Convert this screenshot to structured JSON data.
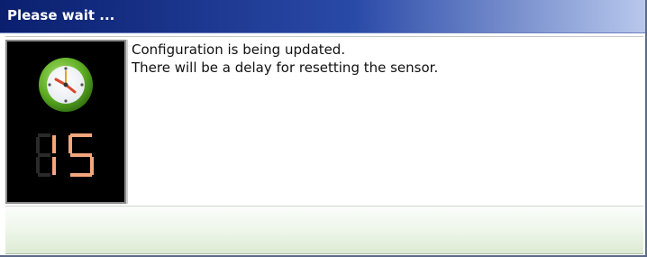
{
  "dialog": {
    "title": "Please wait ...",
    "message_line1": "Configuration is being updated.",
    "message_line2": "There will be a delay for resetting the sensor."
  },
  "countdown": {
    "value": "15",
    "digit_on_color": "#f4a67c",
    "digit_off_color": "#2a2a2a"
  },
  "colors": {
    "titlebar_start": "#0a1f6e",
    "titlebar_end": "#b8c8ec",
    "clock_ring": "#6dbb2e",
    "clock_face": "#ffffff",
    "icon_background": "#000000"
  },
  "icons": {
    "status": "clock-icon"
  }
}
